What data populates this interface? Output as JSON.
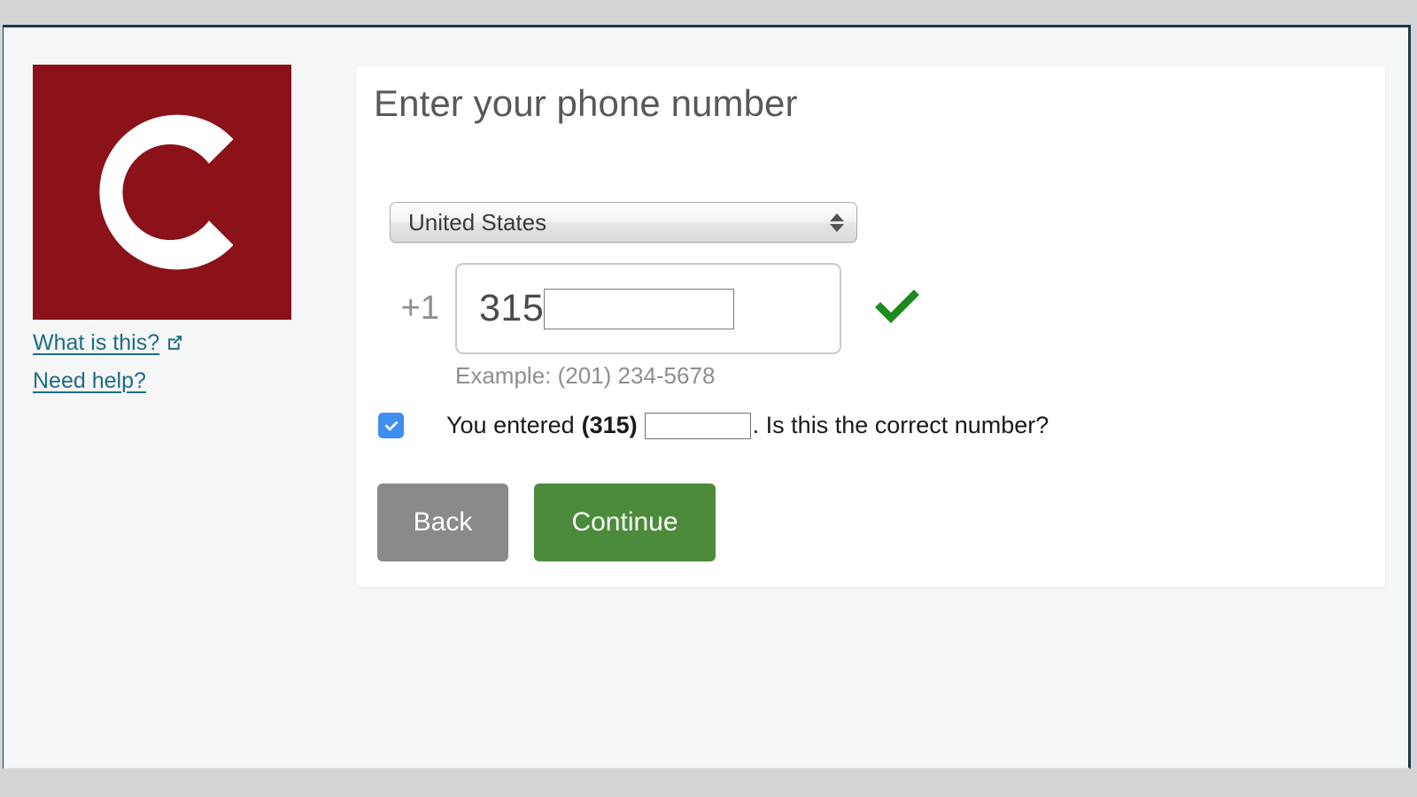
{
  "browser": {
    "chrome_color": "#d2d4d6",
    "page_border_color": "#1d3644"
  },
  "brand": {
    "logo_letter": "C",
    "logo_bg": "#8b1219",
    "logo_fg": "#ffffff"
  },
  "sidebar": {
    "links": [
      {
        "label": "What is this?",
        "icon": "external-link-icon",
        "has_external_icon": true
      },
      {
        "label": "Need help?",
        "icon": "",
        "has_external_icon": false
      }
    ],
    "link_color": "#1f6b86"
  },
  "main": {
    "title": "Enter your phone number",
    "country": {
      "selected": "United States",
      "stepper_icon": "up-down-stepper-icon"
    },
    "phone": {
      "country_code": "+1",
      "area_code": "315",
      "redacted_value": "",
      "valid_icon": "green-check-icon",
      "valid_color": "#1c8a1c",
      "example": "Example: (201) 234-5678"
    },
    "confirm": {
      "checked": true,
      "checkbox_color": "#3f8ef0",
      "text_before": "You entered",
      "bold_area_code": "(315)",
      "redacted_value": "",
      "text_after": ". Is this the correct number?"
    },
    "buttons": {
      "back": {
        "label": "Back",
        "color": "#8a8a8a"
      },
      "continue": {
        "label": "Continue",
        "color": "#4b8b3b"
      }
    }
  }
}
